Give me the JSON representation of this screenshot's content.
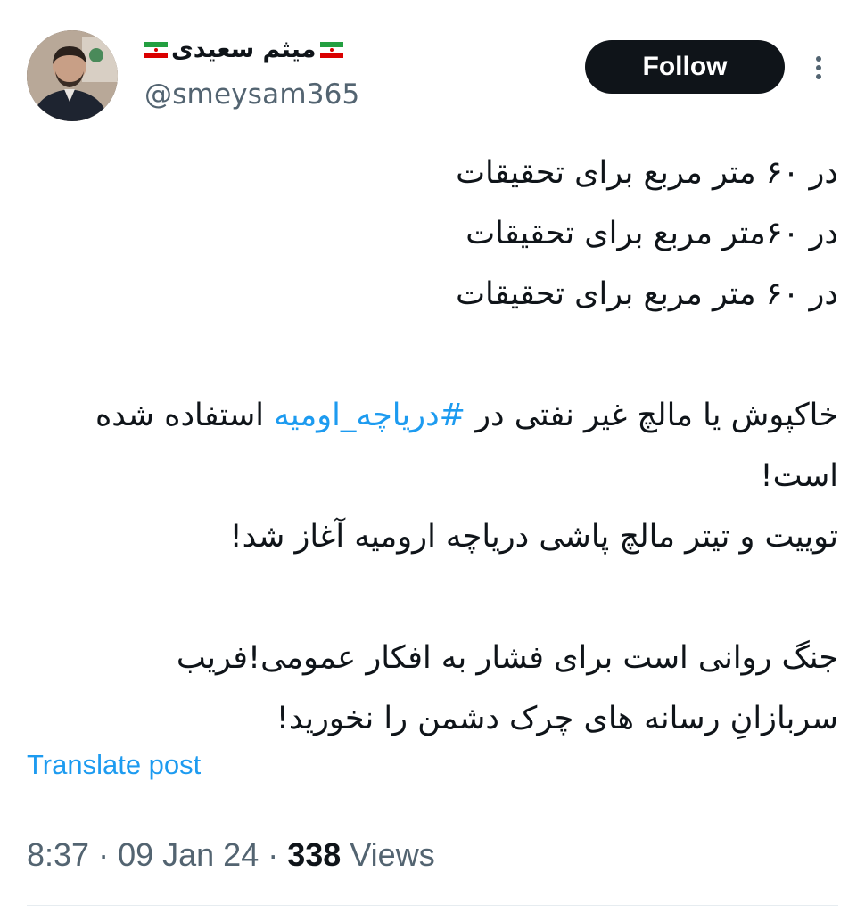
{
  "author": {
    "display_name": "میثم سعیدی",
    "handle": "@smeysam365",
    "flag_icon": "iran-flag-icon"
  },
  "follow_label": "Follow",
  "more_icon": "more-vertical-icon",
  "tweet": {
    "line1": "در ۶۰ متر مربع برای تحقیقات",
    "line2": "در ۶۰متر مربع برای تحقیقات",
    "line3": "در ۶۰ متر مربع برای تحقیقات",
    "para2_before": "خاکپوش یا مالچ غیر نفتی در ",
    "hashtag": "#دریاچه_اومیه",
    "para2_after": " استفاده شده است!",
    "line_tweet": "توییت و تیتر مالچ پاشی دریاچه ارومیه آغاز شد!",
    "line_war": "جنگ روانی است برای فشار به افکار عمومی!فریب",
    "line_soldiers": "سربازانِ رسانه های چرک دشمن را نخورید!"
  },
  "translate_label": "Translate post",
  "meta": {
    "time": "8:37",
    "separator1": "·",
    "date": "09 Jan 24",
    "separator2": "·",
    "views_count": "338",
    "views_label": "Views"
  },
  "colors": {
    "text": "#0f1419",
    "secondary": "#536471",
    "link": "#1d9bf0",
    "button_bg": "#0f1419"
  }
}
